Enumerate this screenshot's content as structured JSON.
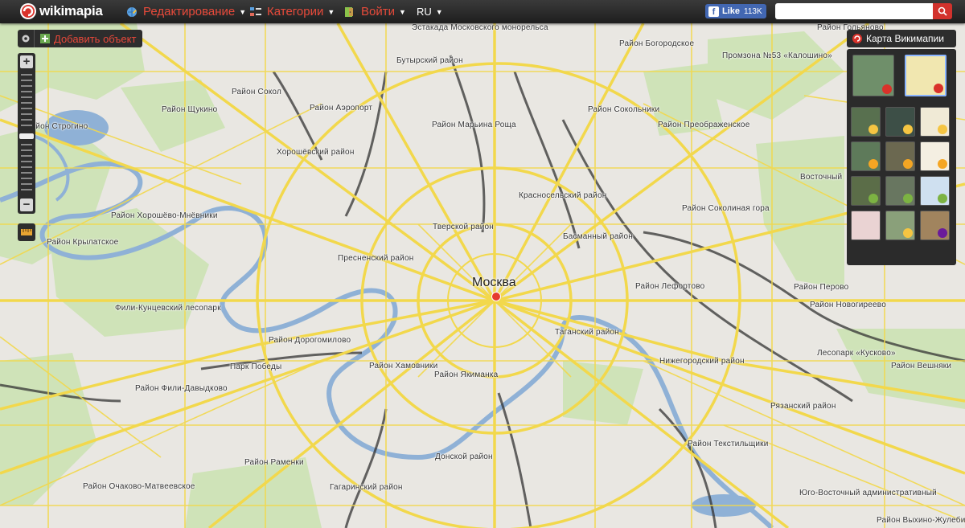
{
  "header": {
    "logo_text": "wikimapia",
    "menu_edit": "Редактирование",
    "menu_categories": "Категории",
    "menu_login": "Войти",
    "lang": "RU",
    "fb_like": "Like",
    "fb_count": "113K",
    "search_placeholder": ""
  },
  "toolbar": {
    "add_object": "Добавить объект"
  },
  "layers": {
    "title": "Карта Викимапии"
  },
  "map": {
    "city": "Москва",
    "labels": [
      "Эстакада Московского монорельса",
      "Район Гольяново",
      "Район Богородское",
      "Бутырский район",
      "Промзона №53 «Калошино»",
      "Район Сокол",
      "Район Щукино",
      "Район Аэропорт",
      "Район Сокольники",
      "Район Строгино",
      "Район Марьина Роща",
      "Район Преображенское",
      "Хорошёвский район",
      "Восточный",
      "Красносельский район",
      "Район Хорошёво-Мнёвники",
      "Тверской район",
      "Район Соколиная гора",
      "Район Крылатское",
      "Басманный район",
      "Пресненский район",
      "Район Лефортово",
      "Район Перово",
      "Фили-Кунцевский лесопарк",
      "Район Новогиреево",
      "Таганский район",
      "Район Дорогомилово",
      "Лесопарк «Кусково»",
      "Парк Победы",
      "Район Хамовники",
      "Нижегородский район",
      "Район Вешняки",
      "Район Фили-Давыдково",
      "Район Якиманка",
      "Рязанский район",
      "Район Текстильщики",
      "Донской район",
      "Район Раменки",
      "Гагаринский район",
      "Район Очаково-Матвеевское",
      "Юго-Восточный административный",
      "Район Выхино-Жулеби"
    ]
  }
}
